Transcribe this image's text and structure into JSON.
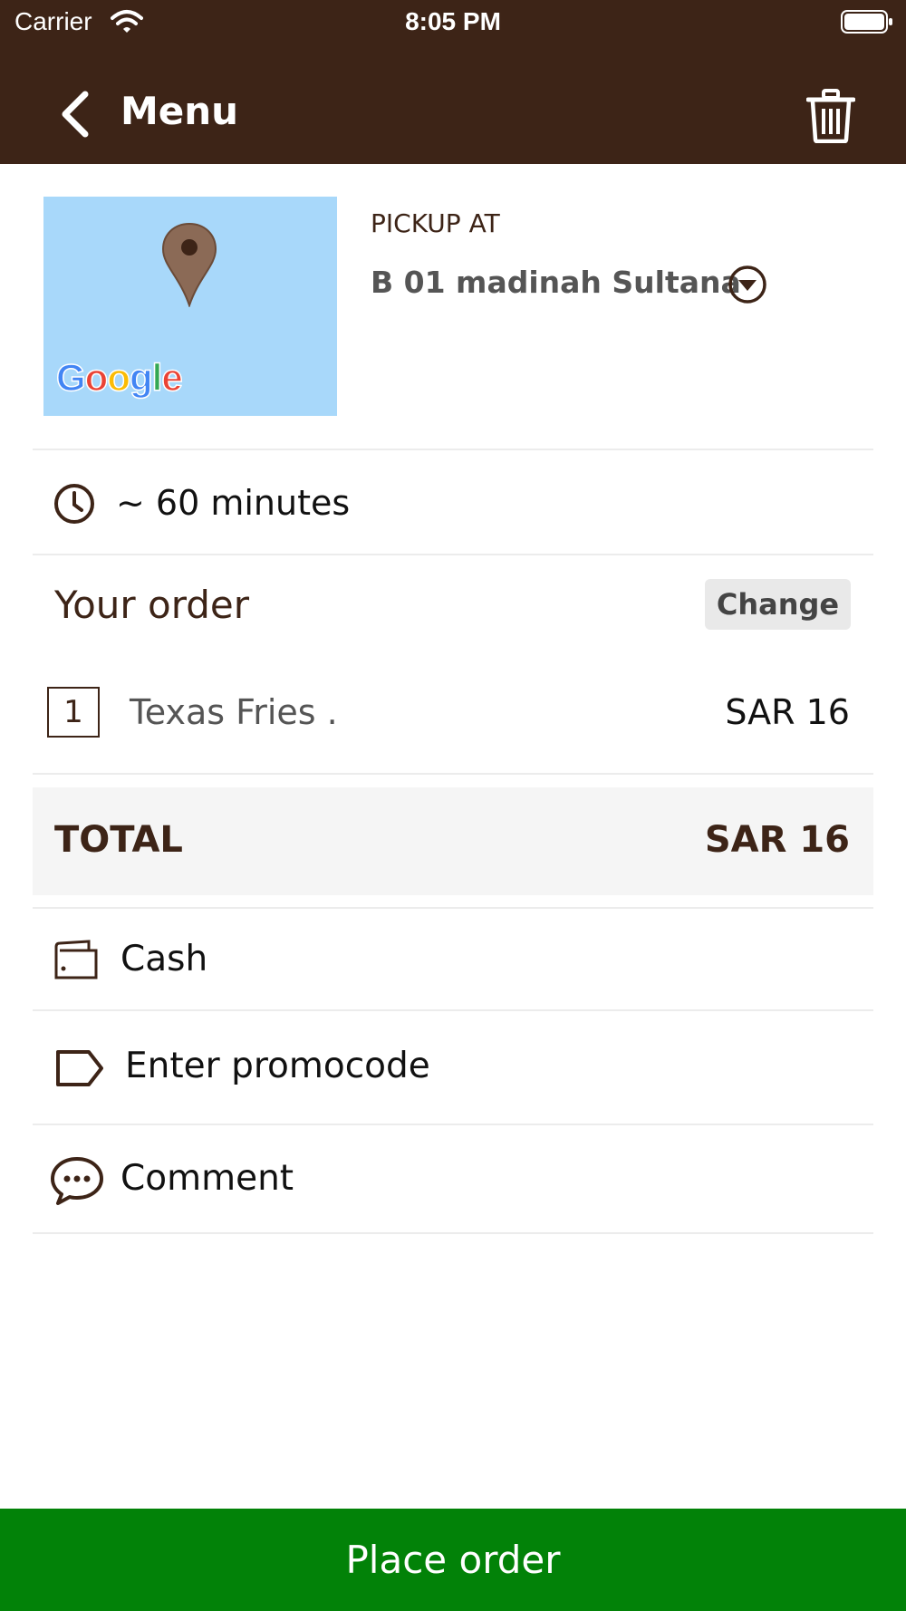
{
  "status_bar": {
    "carrier": "Carrier",
    "time": "8:05 PM"
  },
  "nav": {
    "title": "Menu"
  },
  "pickup": {
    "label": "PICKUP AT",
    "address": "B 01 madinah Sultana",
    "map_logo": "Google"
  },
  "eta": {
    "text": "~ 60 minutes"
  },
  "order": {
    "heading": "Your order",
    "change_label": "Change",
    "items": [
      {
        "qty": "1",
        "name": "Texas Fries .",
        "price": "SAR 16"
      }
    ]
  },
  "total": {
    "label": "TOTAL",
    "value": "SAR 16"
  },
  "payment": {
    "label": "Cash"
  },
  "promo": {
    "label": "Enter promocode"
  },
  "comment": {
    "label": "Comment"
  },
  "place_order": {
    "label": "Place order"
  },
  "colors": {
    "brand": "#3d2417",
    "primary_action": "#028208",
    "map_bg": "#a8d8fa"
  },
  "icons": [
    "wifi-icon",
    "battery-icon",
    "back-chevron-icon",
    "trash-icon",
    "map-pin-icon",
    "dropdown-circle-icon",
    "clock-icon",
    "wallet-icon",
    "tag-icon",
    "comment-bubble-icon"
  ]
}
